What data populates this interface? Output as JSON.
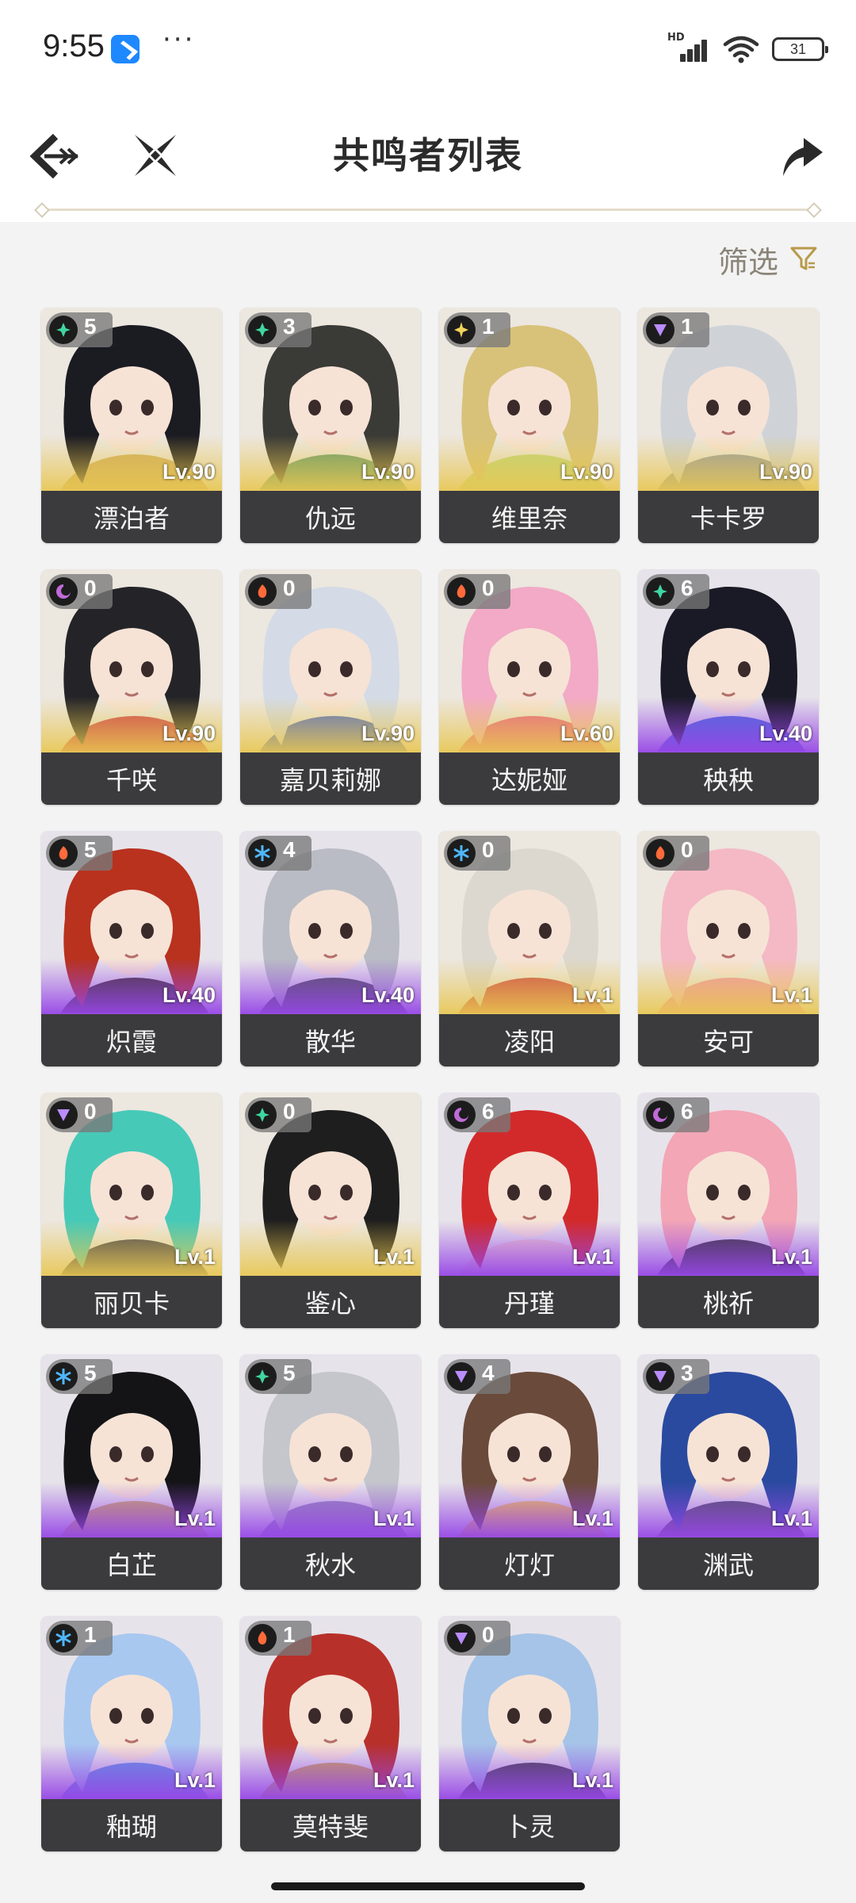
{
  "status_bar": {
    "time": "9:55",
    "app_icon": "blue-arrow-app-icon",
    "dots": "···",
    "network": "HD",
    "battery": "31"
  },
  "header": {
    "title": "共鸣者列表",
    "back_icon": "back-arrow-icon",
    "close_icon": "crossed-blades-icon",
    "share_icon": "share-arrow-icon"
  },
  "filter": {
    "label": "筛选",
    "icon": "funnel-icon",
    "accent": "#b99a4a"
  },
  "colors": {
    "rarity_5": "#e8c650",
    "rarity_4": "#9646e6",
    "name_bar": "#3b3b3d",
    "elements": {
      "aero": "#3fd6a0",
      "spectro": "#f0d35a",
      "havoc": "#c06ad8",
      "fusion": "#ff6a3a",
      "glacio": "#4fb7ff",
      "electro": "#b98cff"
    }
  },
  "characters": [
    {
      "name": "漂泊者",
      "level": "Lv.90",
      "sequence": "5",
      "element": "aero",
      "rarity": 5,
      "hair": "#1b1b22",
      "accent": "#caa24a"
    },
    {
      "name": "仇远",
      "level": "Lv.90",
      "sequence": "3",
      "element": "aero",
      "rarity": 5,
      "hair": "#3a3a36",
      "accent": "#4f8e5a"
    },
    {
      "name": "维里奈",
      "level": "Lv.90",
      "sequence": "1",
      "element": "spectro",
      "rarity": 5,
      "hair": "#d8c27a",
      "accent": "#b8d46a"
    },
    {
      "name": "卡卡罗",
      "level": "Lv.90",
      "sequence": "1",
      "element": "electro",
      "rarity": 5,
      "hair": "#cfd3d8",
      "accent": "#8a8f99"
    },
    {
      "name": "千咲",
      "level": "Lv.90",
      "sequence": "0",
      "element": "havoc",
      "rarity": 5,
      "hair": "#242428",
      "accent": "#c8283a"
    },
    {
      "name": "嘉贝莉娜",
      "level": "Lv.90",
      "sequence": "0",
      "element": "fusion",
      "rarity": 5,
      "hair": "#d4dbe6",
      "accent": "#3c5bc0"
    },
    {
      "name": "达妮娅",
      "level": "Lv.60",
      "sequence": "0",
      "element": "fusion",
      "rarity": 5,
      "hair": "#f2aac6",
      "accent": "#e6507a"
    },
    {
      "name": "秧秧",
      "level": "Lv.40",
      "sequence": "6",
      "element": "aero",
      "rarity": 4,
      "hair": "#1a1a26",
      "accent": "#2f5bd8"
    },
    {
      "name": "炽霞",
      "level": "Lv.40",
      "sequence": "5",
      "element": "fusion",
      "rarity": 4,
      "hair": "#b8321e",
      "accent": "#2a1a1a"
    },
    {
      "name": "散华",
      "level": "Lv.40",
      "sequence": "4",
      "element": "glacio",
      "rarity": 4,
      "hair": "#b9bcc4",
      "accent": "#3a3d48"
    },
    {
      "name": "凌阳",
      "level": "Lv.1",
      "sequence": "0",
      "element": "glacio",
      "rarity": 5,
      "hair": "#dcd8cf",
      "accent": "#c83232"
    },
    {
      "name": "安可",
      "level": "Lv.1",
      "sequence": "0",
      "element": "fusion",
      "rarity": 5,
      "hair": "#f4b9c4",
      "accent": "#f08aa0"
    },
    {
      "name": "丽贝卡",
      "level": "Lv.1",
      "sequence": "0",
      "element": "electro",
      "rarity": 5,
      "hair": "#47c9b8",
      "accent": "#2a2a3c"
    },
    {
      "name": "鉴心",
      "level": "Lv.1",
      "sequence": "0",
      "element": "aero",
      "rarity": 5,
      "hair": "#1e1e1e",
      "accent": "#e8e4da"
    },
    {
      "name": "丹瑾",
      "level": "Lv.1",
      "sequence": "6",
      "element": "havoc",
      "rarity": 4,
      "hair": "#d22a2a",
      "accent": "#f0c8c8"
    },
    {
      "name": "桃祈",
      "level": "Lv.1",
      "sequence": "6",
      "element": "havoc",
      "rarity": 4,
      "hair": "#f2a6b6",
      "accent": "#1c1c1c"
    },
    {
      "name": "白芷",
      "level": "Lv.1",
      "sequence": "5",
      "element": "glacio",
      "rarity": 4,
      "hair": "#141416",
      "accent": "#c8a050"
    },
    {
      "name": "秋水",
      "level": "Lv.1",
      "sequence": "5",
      "element": "aero",
      "rarity": 4,
      "hair": "#c4c6cc",
      "accent": "#8a7bb0"
    },
    {
      "name": "灯灯",
      "level": "Lv.1",
      "sequence": "4",
      "element": "electro",
      "rarity": 4,
      "hair": "#6a4a3a",
      "accent": "#f2c040"
    },
    {
      "name": "渊武",
      "level": "Lv.1",
      "sequence": "3",
      "element": "electro",
      "rarity": 4,
      "hair": "#2a4aa0",
      "accent": "#3a3a52"
    },
    {
      "name": "釉瑚",
      "level": "Lv.1",
      "sequence": "1",
      "element": "glacio",
      "rarity": 4,
      "hair": "#a8c8f0",
      "accent": "#4a88e0"
    },
    {
      "name": "莫特斐",
      "level": "Lv.1",
      "sequence": "1",
      "element": "fusion",
      "rarity": 4,
      "hair": "#b8302a",
      "accent": "#c89a40"
    },
    {
      "name": "卜灵",
      "level": "Lv.1",
      "sequence": "0",
      "element": "electro",
      "rarity": 4,
      "hair": "#a6c4e8",
      "accent": "#2a2a36"
    }
  ]
}
